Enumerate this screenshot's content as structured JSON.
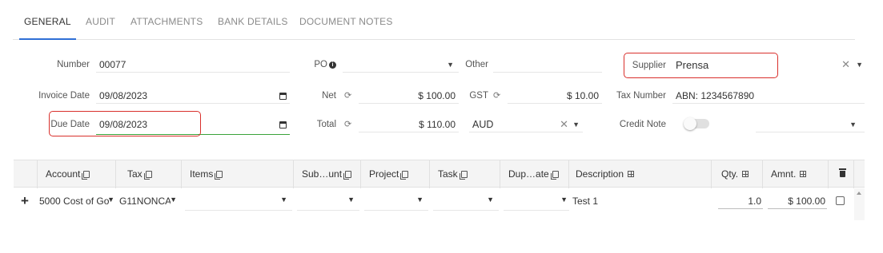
{
  "tabs": [
    {
      "label": "GENERAL",
      "active": true
    },
    {
      "label": "AUDIT",
      "active": false
    },
    {
      "label": "ATTACHMENTS",
      "active": false
    },
    {
      "label": "BANK DETAILS",
      "active": false
    },
    {
      "label": "DOCUMENT NOTES",
      "active": false
    }
  ],
  "form": {
    "number": {
      "label": "Number",
      "value": "00077"
    },
    "invoice_date": {
      "label": "Invoice Date",
      "value": "09/08/2023"
    },
    "due_date": {
      "label": "Due Date",
      "value": "09/08/2023"
    },
    "po": {
      "label": "PO",
      "value": ""
    },
    "net": {
      "label": "Net",
      "value": "$ 100.00"
    },
    "total": {
      "label": "Total",
      "value": "$ 110.00"
    },
    "other": {
      "label": "Other",
      "value": ""
    },
    "gst": {
      "label": "GST",
      "value": "$ 10.00"
    },
    "currency": {
      "value": "AUD"
    },
    "supplier": {
      "label": "Supplier",
      "value": "Prensa"
    },
    "tax_number": {
      "label": "Tax Number",
      "value": "ABN: 1234567890"
    },
    "credit_note": {
      "label": "Credit Note",
      "value": false,
      "select_value": ""
    }
  },
  "grid": {
    "columns": [
      {
        "label": "Account",
        "icon": "copy-icon"
      },
      {
        "label": "Tax",
        "icon": "copy-icon"
      },
      {
        "label": "Items",
        "icon": "copy-icon"
      },
      {
        "label": "Sub…unt",
        "icon": "copy-icon"
      },
      {
        "label": "Project",
        "icon": "copy-icon"
      },
      {
        "label": "Task",
        "icon": "copy-icon"
      },
      {
        "label": "Dup…ate",
        "icon": "copy-icon"
      },
      {
        "label": "Description",
        "icon": "grid-icon"
      },
      {
        "label": "Qty.",
        "icon": "grid-icon"
      },
      {
        "label": "Amnt.",
        "icon": "grid-icon"
      },
      {
        "label": "",
        "icon": "trash-icon"
      }
    ],
    "rows": [
      {
        "account": "5000 Cost of Go",
        "tax": "G11NONCA",
        "items": "",
        "subaccount": "",
        "project": "",
        "task": "",
        "duplicate": "",
        "description": "Test 1",
        "qty": "1.0",
        "amount": "$ 100.00",
        "checked": false
      }
    ]
  },
  "colors": {
    "accent": "#2f6fd6",
    "highlight": "#d9302c",
    "focus": "#3aa33a"
  }
}
